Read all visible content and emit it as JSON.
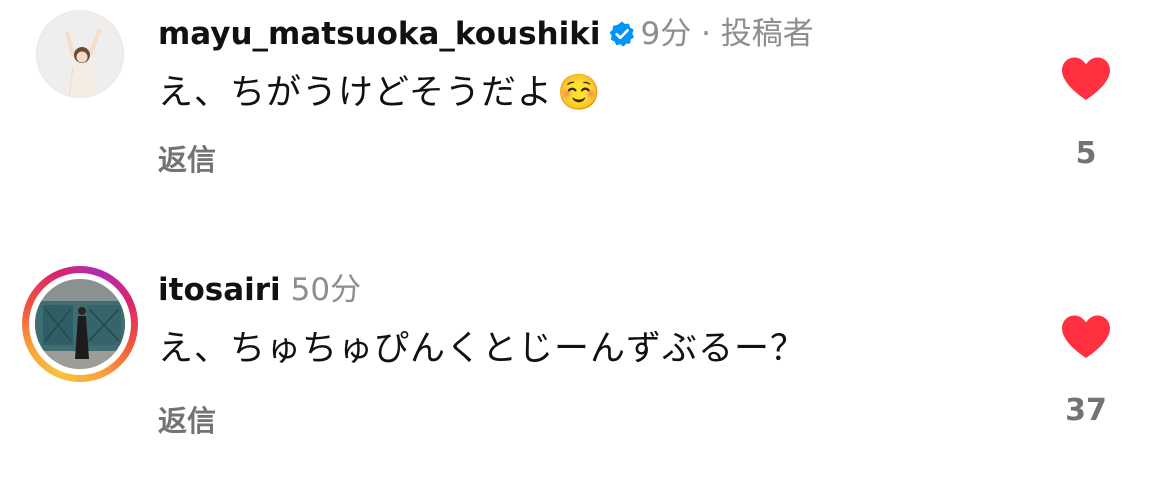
{
  "comments": [
    {
      "username": "mayu_matsuoka_koushiki",
      "verified": true,
      "time": "9分",
      "separator": "·",
      "role_badge": "投稿者",
      "text": "え、ちがうけどそうだよ",
      "emoji": "☺️",
      "reply_label": "返信",
      "likes": "5",
      "liked": true,
      "story_ring": false
    },
    {
      "username": "itosairi",
      "verified": false,
      "time": "50分",
      "text": "え、ちゅちゅぴんくとじーんずぶるー？",
      "reply_label": "返信",
      "likes": "37",
      "liked": true,
      "story_ring": true
    }
  ],
  "colors": {
    "heart": "#ff3040",
    "verified": "#0095f6",
    "meta_text": "#8e8e8e",
    "secondary_text": "#737373"
  }
}
